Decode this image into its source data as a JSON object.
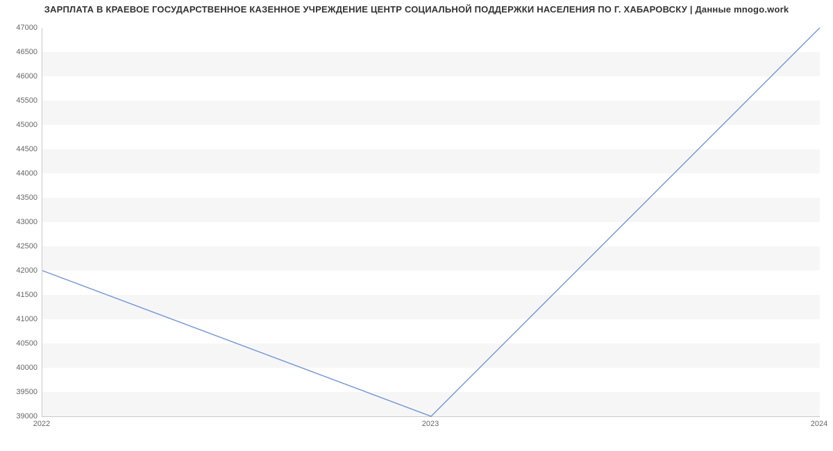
{
  "chart_data": {
    "type": "line",
    "title": "ЗАРПЛАТА В КРАЕВОЕ ГОСУДАРСТВЕННОЕ КАЗЕННОЕ УЧРЕЖДЕНИЕ ЦЕНТР  СОЦИАЛЬНОЙ ПОДДЕРЖКИ НАСЕЛЕНИЯ ПО Г. ХАБАРОВСКУ | Данные mnogo.work",
    "xlabel": "",
    "ylabel": "",
    "x": [
      "2022",
      "2023",
      "2024"
    ],
    "values": [
      42000,
      39000,
      47000
    ],
    "ylim": [
      39000,
      47000
    ],
    "y_ticks": [
      39000,
      39500,
      40000,
      40500,
      41000,
      41500,
      42000,
      42500,
      43000,
      43500,
      44000,
      44500,
      45000,
      45500,
      46000,
      46500,
      47000
    ],
    "line_color": "#6f94d6"
  }
}
